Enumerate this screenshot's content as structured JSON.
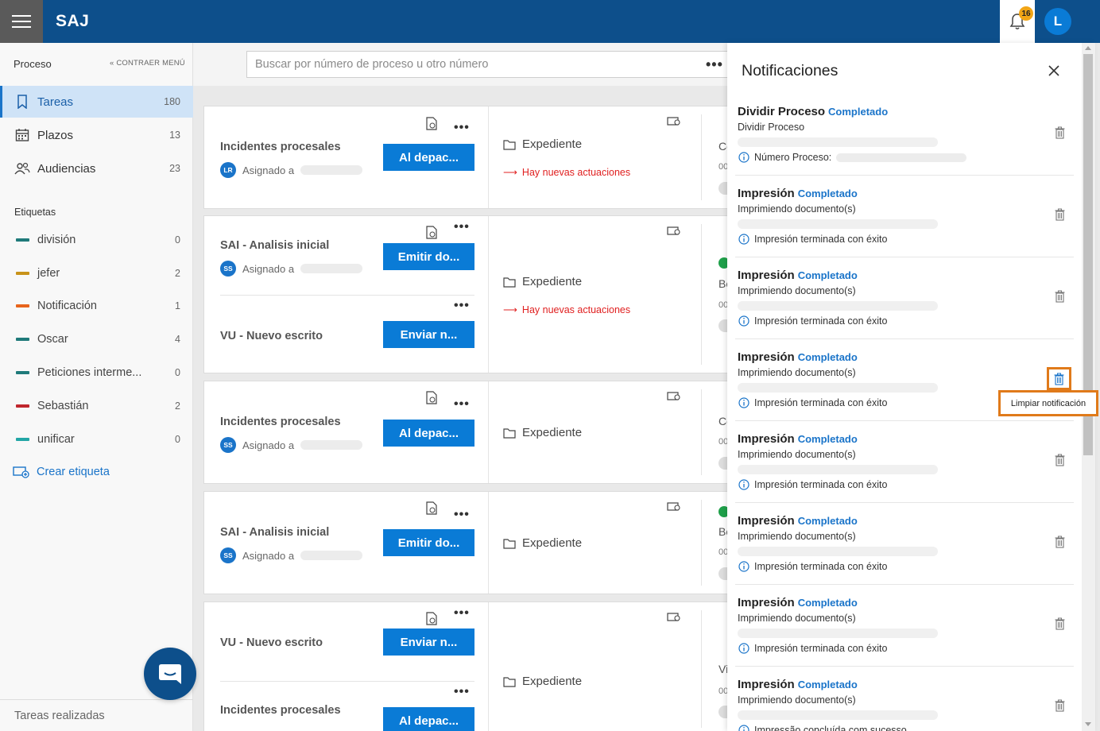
{
  "header": {
    "brand": "SAJ",
    "notif_count": "16",
    "avatar_initial": "L"
  },
  "sidebar": {
    "heading": "Proceso",
    "collapse": "CONTRAER MENÚ",
    "nav": [
      {
        "label": "Tareas",
        "count": "180"
      },
      {
        "label": "Plazos",
        "count": "13"
      },
      {
        "label": "Audiencias",
        "count": "23"
      }
    ],
    "tags_heading": "Etiquetas",
    "tags": [
      {
        "label": "división",
        "count": "0",
        "color": "#1f7a7a"
      },
      {
        "label": "jefer",
        "count": "2",
        "color": "#c8931a"
      },
      {
        "label": "Notificación",
        "count": "1",
        "color": "#e8641c"
      },
      {
        "label": "Oscar",
        "count": "4",
        "color": "#1f7a7a"
      },
      {
        "label": "Peticiones interme...",
        "count": "0",
        "color": "#1f7a7a"
      },
      {
        "label": "Sebastián",
        "count": "2",
        "color": "#c0262d"
      },
      {
        "label": "unificar",
        "count": "0",
        "color": "#22a6a6"
      }
    ],
    "create_tag": "Crear etiqueta",
    "bottom": "Tareas realizadas"
  },
  "search": {
    "placeholder": "Buscar por número de proceso u otro número",
    "more": "•••"
  },
  "tasks": {
    "c1": {
      "title": "Incidentes procesales",
      "initials": "LR",
      "assigned": "Asignado a",
      "button": "Al depac...",
      "exp": "Expediente",
      "news": "Hay nuevas actuaciones",
      "peek": "Co",
      "peek_sm": "00"
    },
    "c2a": {
      "title": "SAI - Analisis inicial",
      "initials": "SS",
      "assigned": "Asignado a",
      "button": "Emitir do...",
      "exp": "Expediente",
      "news": "Hay nuevas actuaciones",
      "peek": "Be",
      "peek_sm": "00"
    },
    "c2b": {
      "title": "VU - Nuevo escrito",
      "button": "Enviar n..."
    },
    "c3": {
      "title": "Incidentes procesales",
      "initials": "SS",
      "assigned": "Asignado a",
      "button": "Al depac...",
      "exp": "Expediente",
      "peek": "Co",
      "peek_sm": "00"
    },
    "c4": {
      "title": "SAI - Analisis inicial",
      "initials": "SS",
      "assigned": "Asignado a",
      "button": "Emitir do...",
      "exp": "Expediente",
      "peek": "Be",
      "peek_sm": "00"
    },
    "c5a": {
      "title": "VU - Nuevo escrito",
      "button": "Enviar n...",
      "exp": "Expediente",
      "peek": "Vi",
      "peek_sm": "00"
    },
    "c5b": {
      "title": "Incidentes procesales",
      "button": "Al depac..."
    }
  },
  "notifications": {
    "title": "Notificaciones",
    "tooltip": "Limpiar notificación",
    "items": [
      {
        "title": "Dividir Proceso",
        "status": "Completado",
        "sub": "Dividir Proceso",
        "info": "Número Proceso:"
      },
      {
        "title": "Impresión",
        "status": "Completado",
        "sub": "Imprimiendo documento(s)",
        "info": "Impresión terminada con éxito"
      },
      {
        "title": "Impresión",
        "status": "Completado",
        "sub": "Imprimiendo documento(s)",
        "info": "Impresión terminada con éxito"
      },
      {
        "title": "Impresión",
        "status": "Completado",
        "sub": "Imprimiendo documento(s)",
        "info": "Impresión terminada con éxito"
      },
      {
        "title": "Impresión",
        "status": "Completado",
        "sub": "Imprimiendo documento(s)",
        "info": "Impresión terminada con éxito"
      },
      {
        "title": "Impresión",
        "status": "Completado",
        "sub": "Imprimiendo documento(s)",
        "info": "Impresión terminada con éxito"
      },
      {
        "title": "Impresión",
        "status": "Completado",
        "sub": "Imprimiendo documento(s)",
        "info": "Impresión terminada con éxito"
      },
      {
        "title": "Impresión",
        "status": "Completado",
        "sub": "Imprimiendo documento(s)",
        "info": "Impressão concluída com sucesso"
      }
    ]
  }
}
